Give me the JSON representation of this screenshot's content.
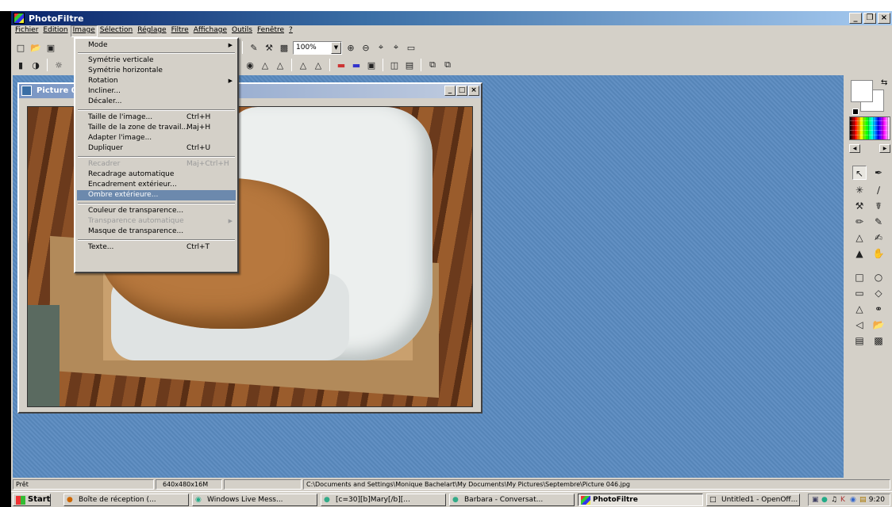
{
  "app": {
    "title": "PhotoFiltre",
    "window_buttons": [
      "_",
      "❒",
      "×"
    ]
  },
  "menubar": [
    "Fichier",
    "Edition",
    "Image",
    "Sélection",
    "Réglage",
    "Filtre",
    "Affichage",
    "Outils",
    "Fenêtre",
    "?"
  ],
  "toolbar": {
    "zoom_value": "100%"
  },
  "image_window": {
    "title": "Picture 0",
    "buttons": [
      "_",
      "□",
      "×"
    ]
  },
  "image_menu": {
    "items": [
      {
        "label": "Mode",
        "shortcut": "",
        "submenu": true,
        "disabled": false
      },
      {
        "label": "Symétrie verticale",
        "shortcut": "",
        "submenu": false,
        "disabled": false
      },
      {
        "label": "Symétrie horizontale",
        "shortcut": "",
        "submenu": false,
        "disabled": false
      },
      {
        "label": "Rotation",
        "shortcut": "",
        "submenu": true,
        "disabled": false
      },
      {
        "label": "Incliner...",
        "shortcut": "",
        "submenu": false,
        "disabled": false
      },
      {
        "label": "Décaler...",
        "shortcut": "",
        "submenu": false,
        "disabled": false
      },
      {
        "label": "Taille de l'image...",
        "shortcut": "Ctrl+H",
        "submenu": false,
        "disabled": false
      },
      {
        "label": "Taille de la zone de travail...",
        "shortcut": "Maj+H",
        "submenu": false,
        "disabled": false
      },
      {
        "label": "Adapter l'image...",
        "shortcut": "",
        "submenu": false,
        "disabled": false
      },
      {
        "label": "Dupliquer",
        "shortcut": "Ctrl+U",
        "submenu": false,
        "disabled": false
      },
      {
        "label": "Recadrer",
        "shortcut": "Maj+Ctrl+H",
        "submenu": false,
        "disabled": true
      },
      {
        "label": "Recadrage automatique",
        "shortcut": "",
        "submenu": false,
        "disabled": false
      },
      {
        "label": "Encadrement extérieur...",
        "shortcut": "",
        "submenu": false,
        "disabled": false
      },
      {
        "label": "Ombre extérieure...",
        "shortcut": "",
        "submenu": false,
        "disabled": false,
        "highlighted": true
      },
      {
        "label": "Couleur de transparence...",
        "shortcut": "",
        "submenu": false,
        "disabled": false
      },
      {
        "label": "Transparence automatique",
        "shortcut": "",
        "submenu": true,
        "disabled": true
      },
      {
        "label": "Masque de transparence...",
        "shortcut": "",
        "submenu": false,
        "disabled": false
      },
      {
        "label": "Texte...",
        "shortcut": "Ctrl+T",
        "submenu": false,
        "disabled": false
      }
    ]
  },
  "statusbar": {
    "state": "Prêt",
    "dimensions": "640x480x16M",
    "path": "C:\\Documents and Settings\\Monique Bachelart\\My Documents\\My Pictures\\Septembre\\Picture 046.jpg"
  },
  "taskbar": {
    "start_label": "Start",
    "tasks": [
      {
        "label": "Boîte de réception (...",
        "icon": "mail-icon",
        "active": false
      },
      {
        "label": "Windows Live Mess...",
        "icon": "messenger-icon",
        "active": false
      },
      {
        "label": "[c=30][b]Mary[/b][...",
        "icon": "chat-icon",
        "active": false
      },
      {
        "label": "Barbara - Conversat...",
        "icon": "chat-icon",
        "active": false
      },
      {
        "label": "PhotoFiltre",
        "icon": "photofiltre-icon",
        "active": true
      },
      {
        "label": "Untitled1 - OpenOff...",
        "icon": "document-icon",
        "active": false
      }
    ],
    "clock": "9:20"
  },
  "colors": {
    "workspace": "#5a8ac0",
    "title_active": "#0a246a",
    "menu_highlight": "#6c89ad"
  }
}
